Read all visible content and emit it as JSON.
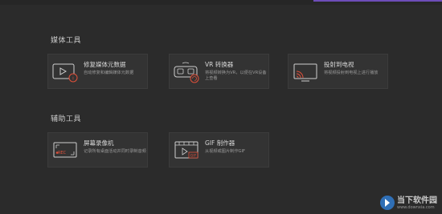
{
  "sections": [
    {
      "title": "媒体工具",
      "tools": [
        {
          "title": "修复媒体元数据",
          "desc": "自动修复和编辑媒体元数据",
          "icon": "video-info-icon"
        },
        {
          "title": "VR 转换器",
          "desc": "将视频转换为VR，以便在VR设备上查看",
          "icon": "vr-headset-icon"
        },
        {
          "title": "投射到电视",
          "desc": "将视频投射到电视上进行播放",
          "icon": "cast-tv-icon"
        }
      ]
    },
    {
      "title": "辅助工具",
      "tools": [
        {
          "title": "屏幕录像机",
          "desc": "记录所有桌面活动并同时录制音频",
          "icon": "screen-recorder-icon"
        },
        {
          "title": "GIF 制作器",
          "desc": "从视频或图片制作GIF",
          "icon": "gif-maker-icon"
        }
      ]
    }
  ],
  "watermark": {
    "name": "当下软件园",
    "url": "www.downxia.com"
  },
  "colors": {
    "accent": "#e0503a",
    "background": "#2b2b2b",
    "card": "#333333",
    "topAccent": "#6d4db8"
  }
}
